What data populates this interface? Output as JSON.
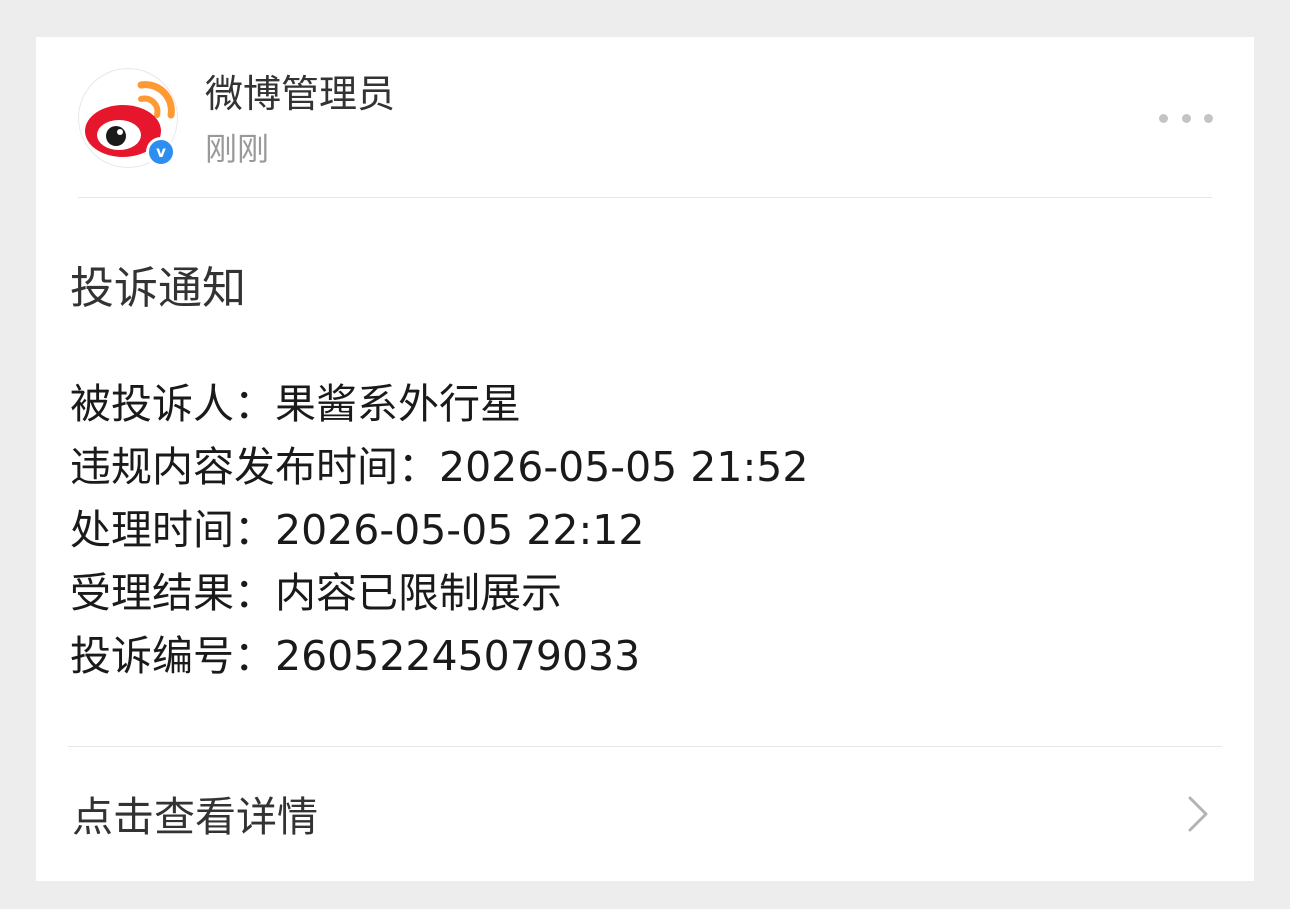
{
  "sender": {
    "name": "微博管理员",
    "time": "刚刚",
    "verified_badge": "v",
    "avatar_icon": "weibo-logo-icon"
  },
  "more_icon": "more-horizontal-icon",
  "notice": {
    "title": "投诉通知",
    "rows": [
      {
        "label": "被投诉人：",
        "value": "果酱系外行星"
      },
      {
        "label": "违规内容发布时间：",
        "value": "2026-05-05 21:52"
      },
      {
        "label": "处理时间：",
        "value": "2026-05-05 22:12"
      },
      {
        "label": "受理结果：",
        "value": "内容已限制展示"
      },
      {
        "label": "投诉编号：",
        "value": "26052245079033"
      }
    ]
  },
  "footer": {
    "view_details_label": "点击查看详情",
    "chevron_icon": "chevron-right-icon"
  },
  "colors": {
    "page_background": "#ededed",
    "card_background": "#ffffff",
    "weibo_red": "#e6162d",
    "weibo_orange": "#ff9933",
    "verified_blue": "#2d8ef2",
    "secondary_text": "#999999"
  }
}
